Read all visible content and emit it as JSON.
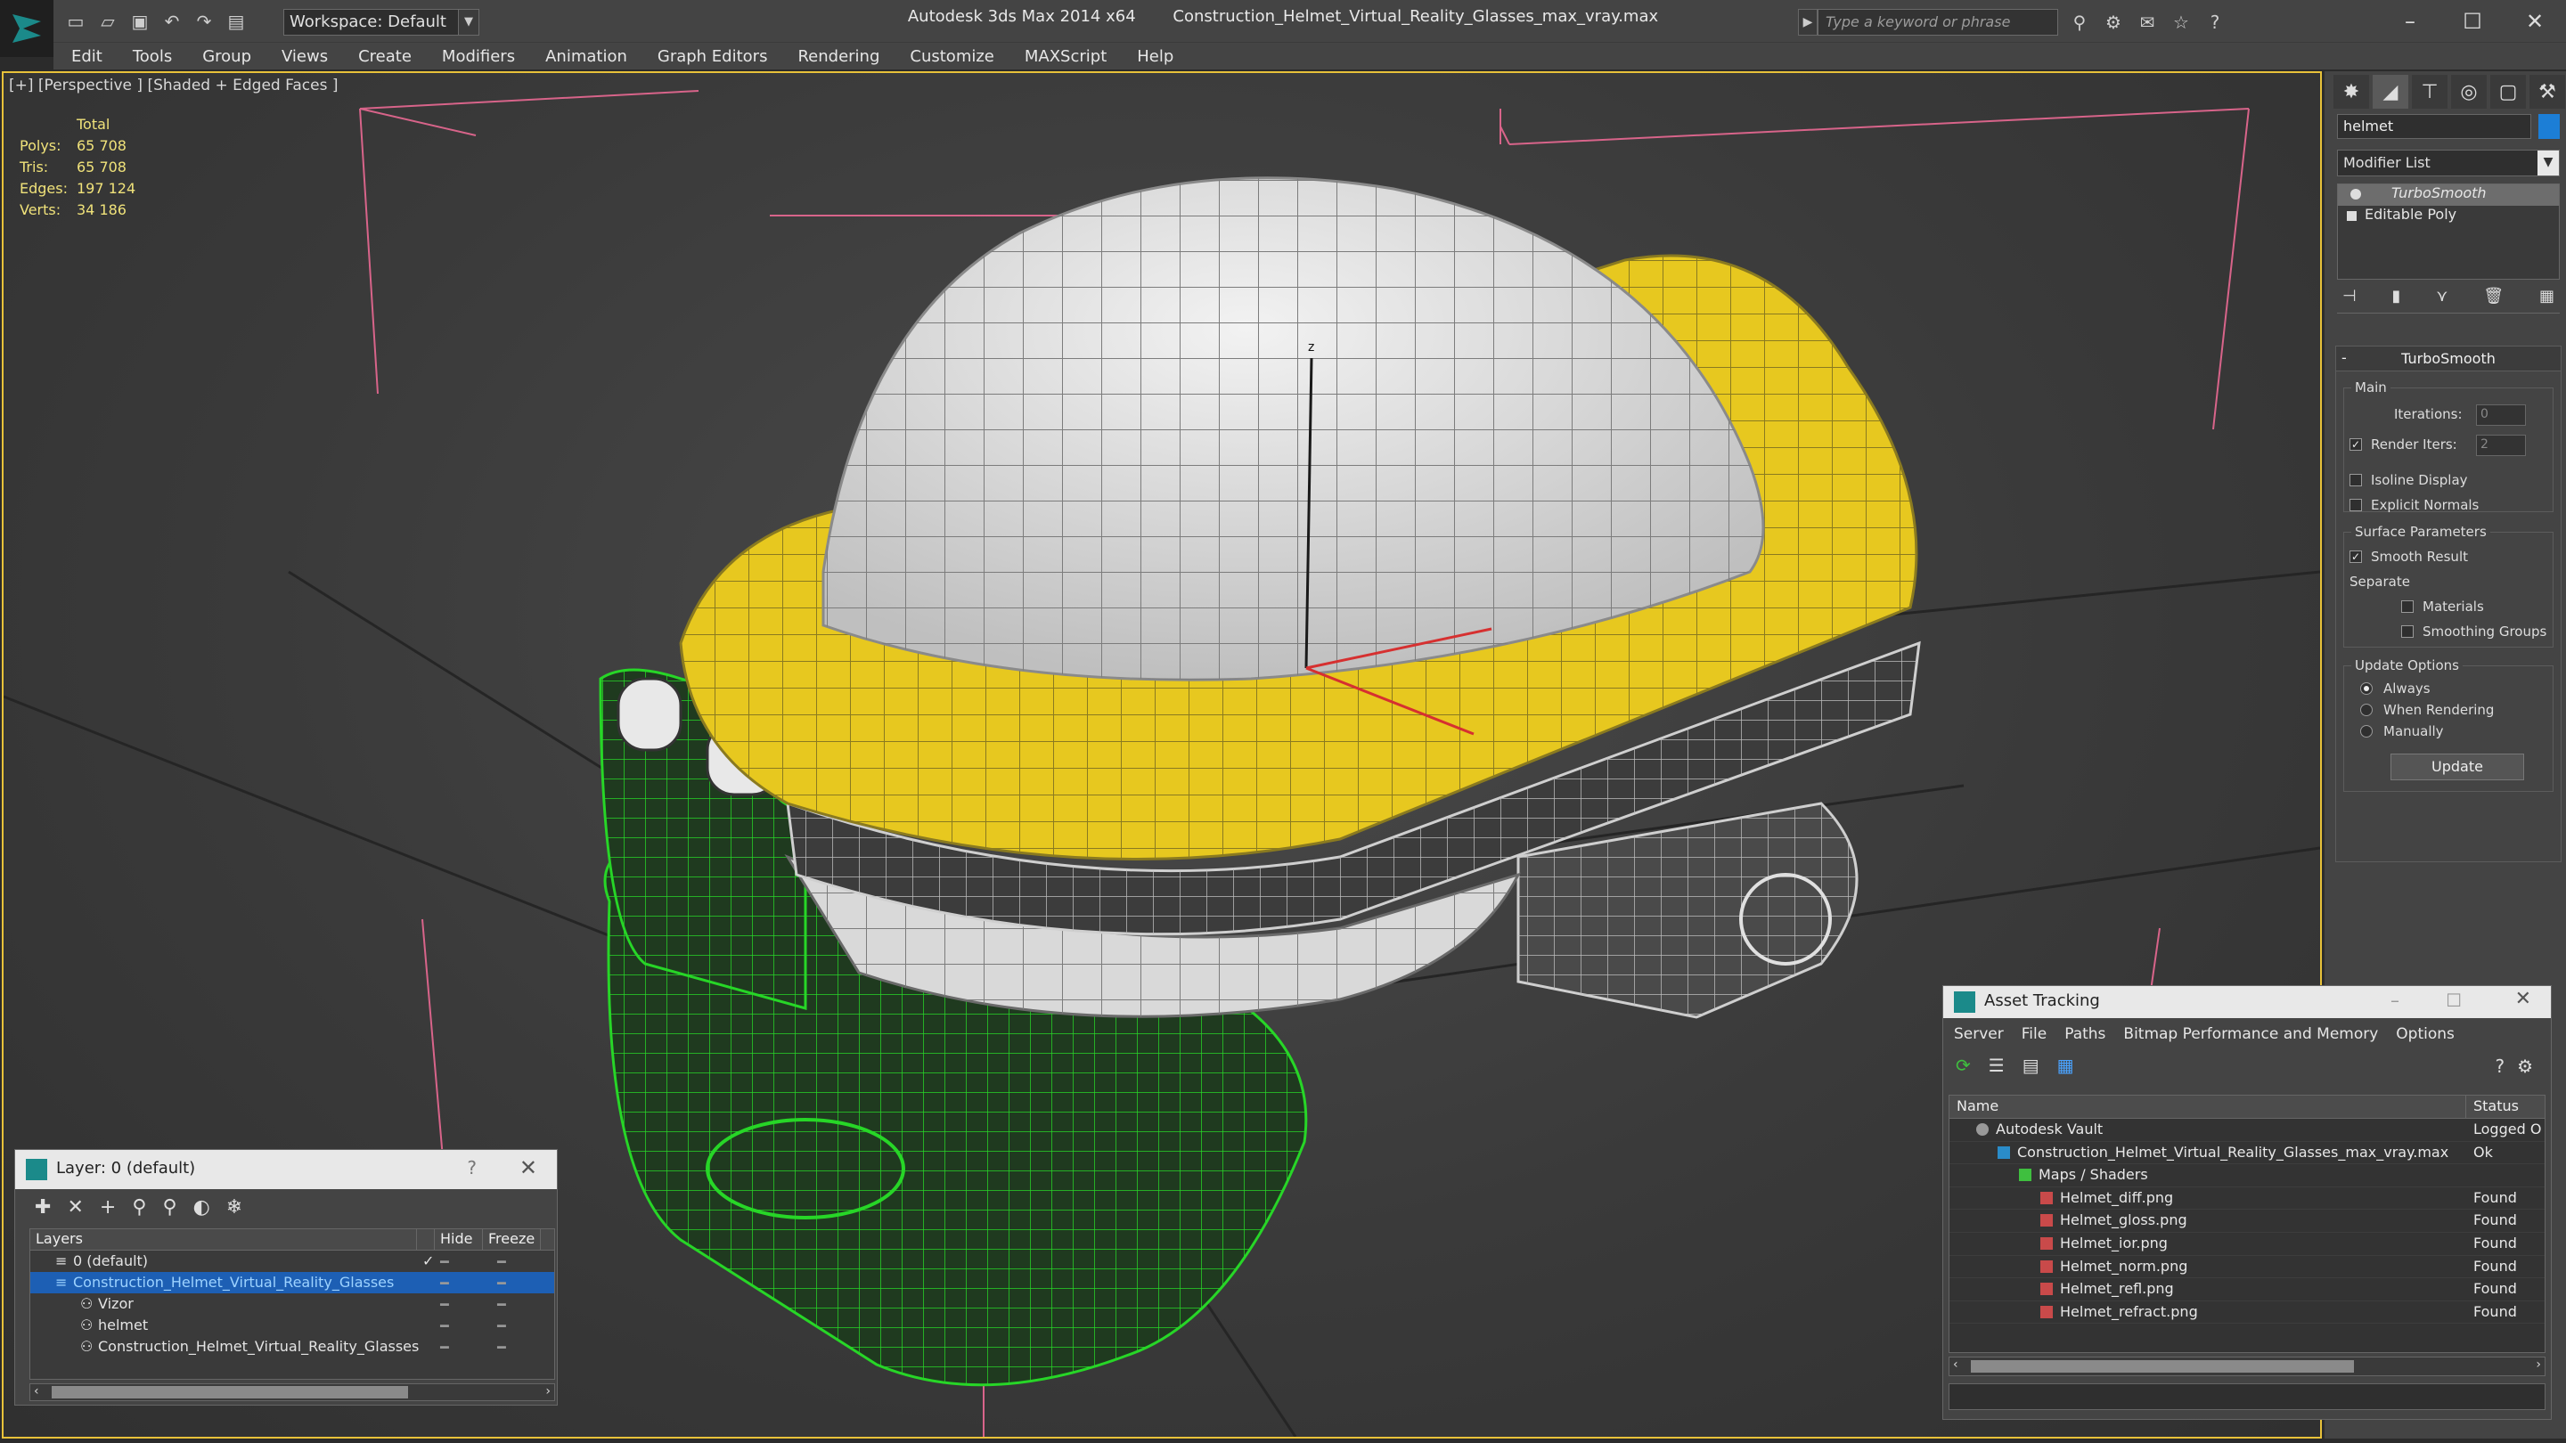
{
  "window": {
    "app_title": "Autodesk 3ds Max  2014 x64",
    "file_title": "Construction_Helmet_Virtual_Reality_Glasses_max_vray.max",
    "workspace": "Workspace: Default",
    "search_placeholder": "Type a keyword or phrase"
  },
  "menu": [
    "Edit",
    "Tools",
    "Group",
    "Views",
    "Create",
    "Modifiers",
    "Animation",
    "Graph Editors",
    "Rendering",
    "Customize",
    "MAXScript",
    "Help"
  ],
  "viewport": {
    "label": "[+] [Perspective ] [Shaded + Edged Faces ]",
    "stats_header": "Total",
    "stats": [
      {
        "k": "Polys:",
        "v": "65 708"
      },
      {
        "k": "Tris:",
        "v": "65 708"
      },
      {
        "k": "Edges:",
        "v": "197 124"
      },
      {
        "k": "Verts:",
        "v": "34 186"
      }
    ],
    "axis_label": "z"
  },
  "command_panel": {
    "object_name": "helmet",
    "object_color": "#1c7ed6",
    "modifier_list": "Modifier List",
    "stack": [
      "TurboSmooth",
      "Editable Poly"
    ],
    "rollout_title": "TurboSmooth",
    "main_label": "Main",
    "iterations_label": "Iterations:",
    "iterations_value": "0",
    "render_iters_label": "Render Iters:",
    "render_iters_value": "2",
    "isoline": "Isoline Display",
    "explicit": "Explicit Normals",
    "surface_params": "Surface Parameters",
    "smooth_result": "Smooth Result",
    "separate": "Separate",
    "materials": "Materials",
    "smoothing_groups": "Smoothing Groups",
    "update_options": "Update Options",
    "always": "Always",
    "when_rendering": "When Rendering",
    "manually": "Manually",
    "update_button": "Update"
  },
  "layer_dialog": {
    "title": "Layer: 0 (default)",
    "help": "?",
    "col_layers": "Layers",
    "col_hide": "Hide",
    "col_freeze": "Freeze",
    "rows": [
      {
        "name": "0 (default)"
      },
      {
        "name": "Construction_Helmet_Virtual_Reality_Glasses"
      },
      {
        "name": "Vizor"
      },
      {
        "name": "helmet"
      },
      {
        "name": "Construction_Helmet_Virtual_Reality_Glasses"
      }
    ]
  },
  "asset_tracking": {
    "title": "Asset Tracking",
    "menu": [
      "Server",
      "File",
      "Paths",
      "Bitmap Performance and Memory",
      "Options"
    ],
    "col_name": "Name",
    "col_status": "Status",
    "rows": [
      {
        "name": "Autodesk Vault",
        "status": "Logged O"
      },
      {
        "name": "Construction_Helmet_Virtual_Reality_Glasses_max_vray.max",
        "status": "Ok"
      },
      {
        "name": "Maps / Shaders",
        "status": ""
      },
      {
        "name": "Helmet_diff.png",
        "status": "Found"
      },
      {
        "name": "Helmet_gloss.png",
        "status": "Found"
      },
      {
        "name": "Helmet_ior.png",
        "status": "Found"
      },
      {
        "name": "Helmet_norm.png",
        "status": "Found"
      },
      {
        "name": "Helmet_refl.png",
        "status": "Found"
      },
      {
        "name": "Helmet_refract.png",
        "status": "Found"
      }
    ]
  },
  "colors": {
    "viewport_border": "#e8c23a",
    "helmet_shell": "#d9d9d9",
    "helmet_band": "#e7c81f",
    "visor": "#1f3d1f",
    "wire_green": "#27d627",
    "stats_text": "#f0e27a",
    "selection_blue": "#1d5fb4"
  }
}
